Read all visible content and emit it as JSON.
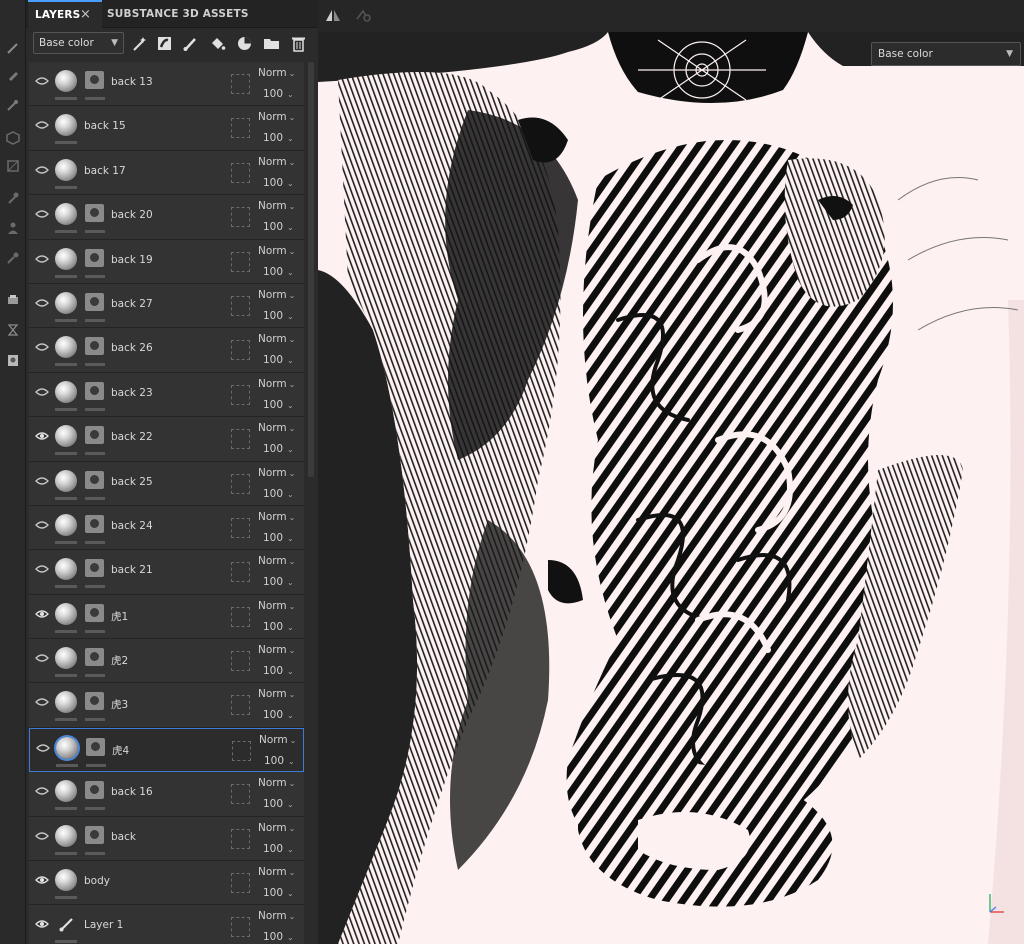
{
  "tabs": {
    "layers": "LAYERS",
    "assets": "SUBSTANCE 3D ASSETS",
    "close_glyph": "×"
  },
  "toolbar": {
    "channel": "Base color"
  },
  "viewport": {
    "channel": "Base color"
  },
  "icons": {
    "toolstrip": [
      "paint-brush-icon",
      "eraser-icon",
      "projection-icon",
      "geometry-mask-icon",
      "polygon-fill-icon",
      "smudge-icon",
      "clone-icon",
      "color-picker-icon",
      "measure-icon",
      "history-icon",
      "bake-icon"
    ],
    "toolbar": [
      "effects-wand-icon",
      "add-mask-icon",
      "add-paint-layer-icon",
      "add-fill-layer-icon",
      "add-smart-material-icon",
      "add-folder-icon",
      "delete-layer-icon"
    ]
  },
  "layers": [
    {
      "name": "back 13",
      "visible": false,
      "mask": true,
      "type": "fill",
      "blend": "Norm",
      "opacity": "100"
    },
    {
      "name": "back 15",
      "visible": false,
      "mask": false,
      "type": "fill",
      "blend": "Norm",
      "opacity": "100"
    },
    {
      "name": "back 17",
      "visible": false,
      "mask": false,
      "type": "fill",
      "blend": "Norm",
      "opacity": "100"
    },
    {
      "name": "back 20",
      "visible": false,
      "mask": true,
      "type": "fill",
      "blend": "Norm",
      "opacity": "100"
    },
    {
      "name": "back 19",
      "visible": false,
      "mask": true,
      "type": "fill",
      "blend": "Norm",
      "opacity": "100"
    },
    {
      "name": "back 27",
      "visible": false,
      "mask": true,
      "type": "fill",
      "blend": "Norm",
      "opacity": "100"
    },
    {
      "name": "back 26",
      "visible": false,
      "mask": true,
      "type": "fill",
      "blend": "Norm",
      "opacity": "100"
    },
    {
      "name": "back 23",
      "visible": false,
      "mask": true,
      "type": "fill",
      "blend": "Norm",
      "opacity": "100"
    },
    {
      "name": "back 22",
      "visible": true,
      "mask": true,
      "type": "fill",
      "blend": "Norm",
      "opacity": "100"
    },
    {
      "name": "back 25",
      "visible": false,
      "mask": true,
      "type": "fill",
      "blend": "Norm",
      "opacity": "100"
    },
    {
      "name": "back 24",
      "visible": false,
      "mask": true,
      "type": "fill",
      "blend": "Norm",
      "opacity": "100"
    },
    {
      "name": "back 21",
      "visible": false,
      "mask": true,
      "type": "fill",
      "blend": "Norm",
      "opacity": "100"
    },
    {
      "name": "虎1",
      "visible": true,
      "mask": true,
      "type": "fill",
      "blend": "Norm",
      "opacity": "100"
    },
    {
      "name": "虎2",
      "visible": false,
      "mask": true,
      "type": "fill",
      "blend": "Norm",
      "opacity": "100"
    },
    {
      "name": "虎3",
      "visible": false,
      "mask": true,
      "type": "fill",
      "blend": "Norm",
      "opacity": "100"
    },
    {
      "name": "虎4",
      "visible": false,
      "mask": true,
      "type": "fill",
      "blend": "Norm",
      "opacity": "100",
      "selected": true
    },
    {
      "name": "back 16",
      "visible": false,
      "mask": true,
      "type": "fill",
      "blend": "Norm",
      "opacity": "100"
    },
    {
      "name": "back",
      "visible": false,
      "mask": true,
      "type": "fill",
      "blend": "Norm",
      "opacity": "100"
    },
    {
      "name": "body",
      "visible": true,
      "mask": false,
      "type": "fill",
      "blend": "Norm",
      "opacity": "100"
    },
    {
      "name": "Layer 1",
      "visible": true,
      "mask": false,
      "type": "paint",
      "blend": "Norm",
      "opacity": "100"
    }
  ],
  "colors": {
    "accent": "#4a9eff",
    "selection": "#3f7ad6",
    "skin": "#fdf1f1",
    "panel": "#2b2b2b",
    "row": "#333333"
  }
}
